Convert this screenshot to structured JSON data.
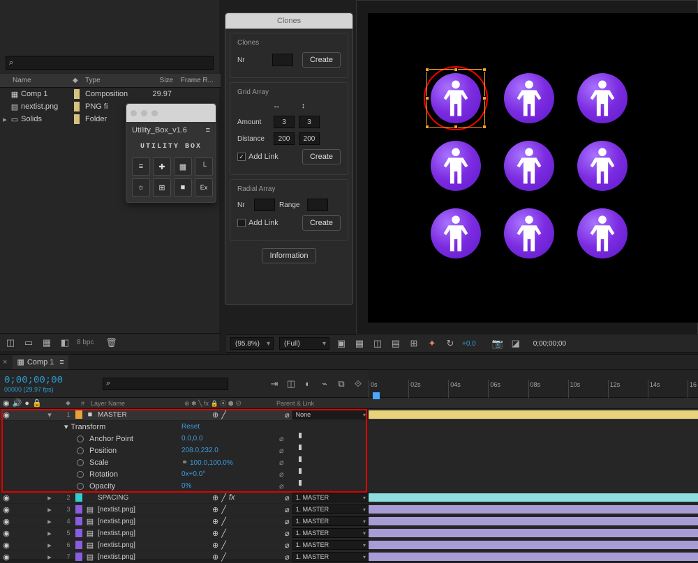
{
  "project": {
    "search_placeholder": "⌕",
    "columns": {
      "name": "Name",
      "type": "Type",
      "size": "Size",
      "frame": "Frame R..."
    },
    "items": [
      {
        "name": "Comp 1",
        "type": "Composition",
        "fps": "29.97",
        "color": "#d6c27e",
        "icon": "comp"
      },
      {
        "name": "nextist.png",
        "type": "PNG fi",
        "color": "#d6c27e",
        "icon": "img"
      },
      {
        "name": "Solids",
        "type": "Folder",
        "color": "#d6c27e",
        "icon": "folder",
        "twirly": "▸"
      }
    ],
    "footer_bpc": "8 bpc"
  },
  "utility_box": {
    "panel_name": "Utility_Box_v1.6",
    "logo": "UTILITY BOX",
    "buttons": [
      "align",
      "plus",
      "grid",
      "corner",
      "sun",
      "quad",
      "cam",
      "ex"
    ]
  },
  "clones": {
    "title": "Clones",
    "sections": {
      "clones": {
        "label": "Clones",
        "nr_label": "Nr",
        "nr": "",
        "create": "Create"
      },
      "grid": {
        "label": "Grid Array",
        "amount_label": "Amount",
        "amount_x": "3",
        "amount_y": "3",
        "distance_label": "Distance",
        "distance_x": "200",
        "distance_y": "200",
        "add_link": "Add Link",
        "add_link_checked": true,
        "create": "Create"
      },
      "radial": {
        "label": "Radial Array",
        "nr_label": "Nr",
        "nr": "",
        "range_label": "Range",
        "range": "",
        "add_link": "Add Link",
        "add_link_checked": false,
        "create": "Create"
      },
      "info": "Information"
    }
  },
  "viewer": {
    "footer": {
      "zoom": "(95.8%)",
      "res": "(Full)",
      "adjust": "+0.0",
      "timecode": "0;00;00;00"
    }
  },
  "timeline": {
    "tab": "Comp 1",
    "tc": "0;00;00;00",
    "tc_sub": "00000 (29.97 fps)",
    "search_placeholder": "⌕",
    "ruler": [
      "0s",
      "02s",
      "04s",
      "06s",
      "08s",
      "10s",
      "12s",
      "14s",
      "16"
    ],
    "col_layername": "Layer Name",
    "col_switches": "⊕ ✱ ╲ fx 🔒 ⦿ ⬢ ⊘",
    "col_parent": "Parent & Link",
    "layers": [
      {
        "idx": "1",
        "name": "MASTER",
        "color": "#e8a23a",
        "parent": "None",
        "sel": true,
        "bar": "#e8d27a",
        "twirly": "▾",
        "solid": "#fff"
      },
      {
        "idx": "2",
        "name": "SPACING",
        "color": "#2fcfcf",
        "parent": "1. MASTER",
        "bar": "#8fdede",
        "twirly": "▸",
        "fx": true
      },
      {
        "idx": "3",
        "name": "[nextist.png]",
        "color": "#8a5ce0",
        "parent": "1. MASTER",
        "bar": "#a89cd6",
        "twirly": "▸",
        "img": true
      },
      {
        "idx": "4",
        "name": "[nextist.png]",
        "color": "#8a5ce0",
        "parent": "1. MASTER",
        "bar": "#a89cd6",
        "twirly": "▸",
        "img": true
      },
      {
        "idx": "5",
        "name": "[nextist.png]",
        "color": "#8a5ce0",
        "parent": "1. MASTER",
        "bar": "#a89cd6",
        "twirly": "▸",
        "img": true
      },
      {
        "idx": "6",
        "name": "[nextist.png]",
        "color": "#8a5ce0",
        "parent": "1. MASTER",
        "bar": "#a89cd6",
        "twirly": "▸",
        "img": true
      },
      {
        "idx": "7",
        "name": "[nextist.png]",
        "color": "#8a5ce0",
        "parent": "1. MASTER",
        "bar": "#a89cd6",
        "twirly": "▸",
        "img": true
      }
    ],
    "transform": {
      "label": "Transform",
      "reset": "Reset",
      "props": [
        {
          "name": "Anchor Point",
          "val": "0.0,0.0"
        },
        {
          "name": "Position",
          "val": "208.0,232.0"
        },
        {
          "name": "Scale",
          "val": "100.0,100.0%",
          "link": true
        },
        {
          "name": "Rotation",
          "val": "0x+0.0°"
        },
        {
          "name": "Opacity",
          "val": "0%"
        }
      ]
    }
  }
}
